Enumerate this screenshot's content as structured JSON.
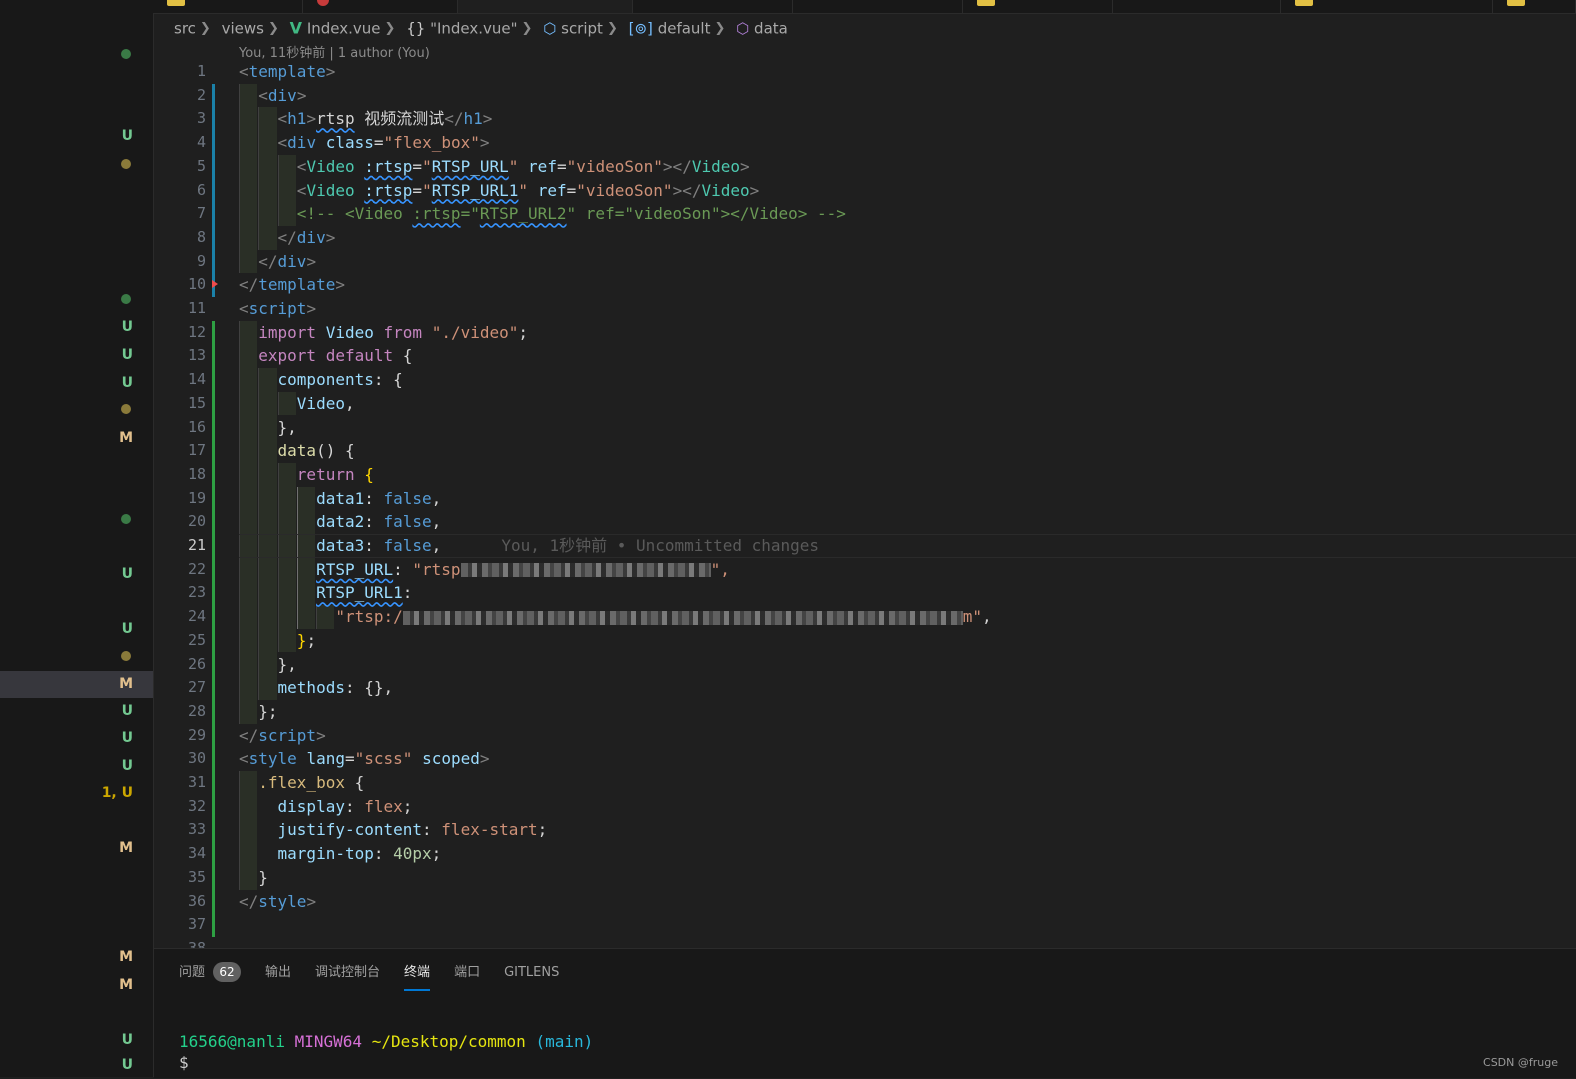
{
  "breadcrumb": {
    "items": [
      "src",
      "views",
      "Index.vue",
      "\"Index.vue\"",
      "script",
      "default",
      "data"
    ],
    "icons": [
      "vue-file-icon",
      "object-braces-icon",
      "cube-icon",
      "field-icon",
      "cube-icon"
    ]
  },
  "codelens": "You, 11秒钟前 | 1 author (You)",
  "scm_decorations": [
    {
      "kind": "dot",
      "color": "#3a7a46"
    },
    {
      "kind": "text",
      "text": "U",
      "color": "#73c991"
    },
    {
      "kind": "dot",
      "color": "#8a7a3a"
    },
    {
      "kind": "dot",
      "color": "#3a7a46"
    },
    {
      "kind": "text",
      "text": "U",
      "color": "#73c991"
    },
    {
      "kind": "text",
      "text": "U",
      "color": "#73c991"
    },
    {
      "kind": "text",
      "text": "U",
      "color": "#73c991"
    },
    {
      "kind": "dot",
      "color": "#8a7a3a"
    },
    {
      "kind": "text",
      "text": "M",
      "color": "#e2c08d"
    },
    {
      "kind": "dot",
      "color": "#3a7a46"
    },
    {
      "kind": "text",
      "text": "U",
      "color": "#73c991"
    },
    {
      "kind": "text",
      "text": "U",
      "color": "#73c991"
    },
    {
      "kind": "dot",
      "color": "#8a7a3a"
    },
    {
      "kind": "text",
      "text": "M",
      "color": "#e2c08d",
      "selected": true
    },
    {
      "kind": "text",
      "text": "U",
      "color": "#73c991"
    },
    {
      "kind": "text",
      "text": "U",
      "color": "#73c991"
    },
    {
      "kind": "text",
      "text": "U",
      "color": "#73c991"
    },
    {
      "kind": "text",
      "text": "1, U",
      "color": "#cca700"
    },
    {
      "kind": "text",
      "text": "M",
      "color": "#e2c08d"
    },
    {
      "kind": "text",
      "text": "M",
      "color": "#e2c08d"
    },
    {
      "kind": "text",
      "text": "M",
      "color": "#e2c08d"
    },
    {
      "kind": "text",
      "text": "U",
      "color": "#73c991"
    },
    {
      "kind": "text",
      "text": "U",
      "color": "#73c991"
    }
  ],
  "editor": {
    "current_line": 21,
    "line_numbers": [
      "1",
      "2",
      "3",
      "4",
      "5",
      "6",
      "7",
      "8",
      "9",
      "10",
      "11",
      "12",
      "13",
      "14",
      "15",
      "16",
      "17",
      "18",
      "19",
      "20",
      "21",
      "22",
      "23",
      "24",
      "25",
      "26",
      "27",
      "28",
      "29",
      "30",
      "31",
      "32",
      "33",
      "34",
      "35",
      "36",
      "37",
      "38"
    ],
    "blame_line": "You, 1秒钟前 • Uncommitted changes",
    "lines": [
      [
        [
          "t-br",
          "<"
        ],
        [
          "t-tag",
          "template"
        ],
        [
          "t-br",
          ">"
        ]
      ],
      [
        [
          "",
          "  "
        ],
        [
          "t-br",
          "<"
        ],
        [
          "t-tag",
          "div"
        ],
        [
          "t-br",
          ">"
        ]
      ],
      [
        [
          "",
          "    "
        ],
        [
          "t-br",
          "<"
        ],
        [
          "t-tag",
          "h1"
        ],
        [
          "t-br",
          ">"
        ],
        [
          "t-plain sq",
          "rtsp"
        ],
        [
          "t-plain",
          " 视频流测试"
        ],
        [
          "t-br",
          "</"
        ],
        [
          "t-tag",
          "h1"
        ],
        [
          "t-br",
          ">"
        ]
      ],
      [
        [
          "",
          "    "
        ],
        [
          "t-br",
          "<"
        ],
        [
          "t-tag",
          "div"
        ],
        [
          "t-plain",
          " "
        ],
        [
          "t-attr",
          "class"
        ],
        [
          "t-plain",
          "="
        ],
        [
          "t-str",
          "\"flex_box\""
        ],
        [
          "t-br",
          ">"
        ]
      ],
      [
        [
          "",
          "      "
        ],
        [
          "t-br",
          "<"
        ],
        [
          "t-cmp",
          "Video"
        ],
        [
          "t-plain",
          " "
        ],
        [
          "t-attr sq",
          ":rtsp"
        ],
        [
          "t-plain",
          "="
        ],
        [
          "t-str",
          "\""
        ],
        [
          "t-var sq",
          "RTSP_URL"
        ],
        [
          "t-str",
          "\""
        ],
        [
          "t-plain",
          " "
        ],
        [
          "t-attr",
          "ref"
        ],
        [
          "t-plain",
          "="
        ],
        [
          "t-str",
          "\"videoSon\""
        ],
        [
          "t-br",
          "></"
        ],
        [
          "t-cmp",
          "Video"
        ],
        [
          "t-br",
          ">"
        ]
      ],
      [
        [
          "",
          "      "
        ],
        [
          "t-br",
          "<"
        ],
        [
          "t-cmp",
          "Video"
        ],
        [
          "t-plain",
          " "
        ],
        [
          "t-attr sq",
          ":rtsp"
        ],
        [
          "t-plain",
          "="
        ],
        [
          "t-str",
          "\""
        ],
        [
          "t-var sq",
          "RTSP_URL1"
        ],
        [
          "t-str",
          "\""
        ],
        [
          "t-plain",
          " "
        ],
        [
          "t-attr",
          "ref"
        ],
        [
          "t-plain",
          "="
        ],
        [
          "t-str",
          "\"videoSon\""
        ],
        [
          "t-br",
          "></"
        ],
        [
          "t-cmp",
          "Video"
        ],
        [
          "t-br",
          ">"
        ]
      ],
      [
        [
          "",
          "      "
        ],
        [
          "t-cmt",
          "<!-- <Video "
        ],
        [
          "t-cmt sq",
          ":rtsp"
        ],
        [
          "t-cmt",
          "=\""
        ],
        [
          "t-cmt sq",
          "RTSP_URL2"
        ],
        [
          "t-cmt",
          "\" ref=\"videoSon\"></Video> -->"
        ]
      ],
      [
        [
          "",
          "    "
        ],
        [
          "t-br",
          "</"
        ],
        [
          "t-tag",
          "div"
        ],
        [
          "t-br",
          ">"
        ]
      ],
      [
        [
          "",
          "  "
        ],
        [
          "t-br",
          "</"
        ],
        [
          "t-tag",
          "div"
        ],
        [
          "t-br",
          ">"
        ]
      ],
      [
        [
          "t-br",
          "</"
        ],
        [
          "t-tag",
          "template"
        ],
        [
          "t-br",
          ">"
        ]
      ],
      [
        [
          "t-br",
          "<"
        ],
        [
          "t-tag",
          "script"
        ],
        [
          "t-br",
          ">"
        ]
      ],
      [
        [
          "",
          "  "
        ],
        [
          "t-kw",
          "import"
        ],
        [
          "t-plain",
          " "
        ],
        [
          "t-var",
          "Video"
        ],
        [
          "t-plain",
          " "
        ],
        [
          "t-kw",
          "from"
        ],
        [
          "t-plain",
          " "
        ],
        [
          "t-str",
          "\"./video\""
        ],
        [
          "t-plain",
          ";"
        ]
      ],
      [
        [
          "",
          "  "
        ],
        [
          "t-kw",
          "export"
        ],
        [
          "t-plain",
          " "
        ],
        [
          "t-kw",
          "default"
        ],
        [
          "t-plain",
          " {"
        ]
      ],
      [
        [
          "",
          "    "
        ],
        [
          "t-prop",
          "components"
        ],
        [
          "t-plain",
          ": {"
        ]
      ],
      [
        [
          "",
          "      "
        ],
        [
          "t-var",
          "Video"
        ],
        [
          "t-plain",
          ","
        ]
      ],
      [
        [
          "",
          "    "
        ],
        [
          "t-plain",
          "},"
        ]
      ],
      [
        [
          "",
          "    "
        ],
        [
          "t-fn",
          "data"
        ],
        [
          "t-plain",
          "() {"
        ]
      ],
      [
        [
          "",
          "      "
        ],
        [
          "t-kw",
          "return"
        ],
        [
          "t-plain",
          " "
        ],
        [
          "t-brace",
          "{"
        ]
      ],
      [
        [
          "",
          "        "
        ],
        [
          "t-prop",
          "data1"
        ],
        [
          "t-plain",
          ": "
        ],
        [
          "t-bool",
          "false"
        ],
        [
          "t-plain",
          ","
        ]
      ],
      [
        [
          "",
          "        "
        ],
        [
          "t-prop",
          "data2"
        ],
        [
          "t-plain",
          ": "
        ],
        [
          "t-bool",
          "false"
        ],
        [
          "t-plain",
          ","
        ]
      ],
      [
        [
          "",
          "        "
        ],
        [
          "t-prop",
          "data3"
        ],
        [
          "t-plain",
          ": "
        ],
        [
          "t-bool",
          "false"
        ],
        [
          "t-plain",
          ","
        ]
      ],
      [
        [
          "",
          "        "
        ],
        [
          "t-prop sq",
          "RTSP_URL"
        ],
        [
          "t-plain",
          ": "
        ],
        [
          "t-str",
          "\"rtsp"
        ],
        [
          "blur:250",
          ""
        ],
        [
          "t-str",
          "\","
        ]
      ],
      [
        [
          "",
          "        "
        ],
        [
          "t-prop sq",
          "RTSP_URL1"
        ],
        [
          "t-plain",
          ":"
        ]
      ],
      [
        [
          "",
          "          "
        ],
        [
          "t-str",
          "\"rtsp:/"
        ],
        [
          "blur:560",
          ""
        ],
        [
          "t-str",
          "m\""
        ],
        [
          "t-plain",
          ","
        ]
      ],
      [
        [
          "",
          "      "
        ],
        [
          "t-brace",
          "}"
        ],
        [
          "t-plain",
          ";"
        ]
      ],
      [
        [
          "",
          "    "
        ],
        [
          "t-plain",
          "},"
        ]
      ],
      [
        [
          "",
          "    "
        ],
        [
          "t-prop",
          "methods"
        ],
        [
          "t-plain",
          ": {},"
        ]
      ],
      [
        [
          "",
          "  "
        ],
        [
          "t-plain",
          "};"
        ]
      ],
      [
        [
          "t-br",
          "</"
        ],
        [
          "t-tag",
          "script"
        ],
        [
          "t-br",
          ">"
        ]
      ],
      [
        [
          "t-br",
          "<"
        ],
        [
          "t-tag",
          "style"
        ],
        [
          "t-plain",
          " "
        ],
        [
          "t-attr",
          "lang"
        ],
        [
          "t-plain",
          "="
        ],
        [
          "t-str",
          "\"scss\""
        ],
        [
          "t-plain",
          " "
        ],
        [
          "t-attr",
          "scoped"
        ],
        [
          "t-br",
          ">"
        ]
      ],
      [
        [
          "",
          "  "
        ],
        [
          "t-sel",
          ".flex_box"
        ],
        [
          "t-plain",
          " {"
        ]
      ],
      [
        [
          "",
          "    "
        ],
        [
          "t-prop",
          "display"
        ],
        [
          "t-plain",
          ": "
        ],
        [
          "t-str",
          "flex"
        ],
        [
          "t-plain",
          ";"
        ]
      ],
      [
        [
          "",
          "    "
        ],
        [
          "t-prop",
          "justify-content"
        ],
        [
          "t-plain",
          ": "
        ],
        [
          "t-str",
          "flex-start"
        ],
        [
          "t-plain",
          ";"
        ]
      ],
      [
        [
          "",
          "    "
        ],
        [
          "t-prop",
          "margin-top"
        ],
        [
          "t-plain",
          ": "
        ],
        [
          "t-num",
          "40px"
        ],
        [
          "t-plain",
          ";"
        ]
      ],
      [
        [
          "",
          "  "
        ],
        [
          "t-plain",
          "}"
        ]
      ],
      [
        [
          "t-br",
          "</"
        ],
        [
          "t-tag",
          "style"
        ],
        [
          "t-br",
          ">"
        ]
      ],
      [],
      []
    ]
  },
  "panel": {
    "tabs": [
      {
        "label": "问题",
        "badge": "62"
      },
      {
        "label": "输出"
      },
      {
        "label": "调试控制台"
      },
      {
        "label": "终端",
        "active": true
      },
      {
        "label": "端口"
      },
      {
        "label": "GITLENS"
      }
    ],
    "terminal": {
      "user_host": "16566@nanli",
      "system": "MINGW64",
      "path": "~/Desktop/common",
      "branch": "(main)",
      "prompt": "$"
    }
  },
  "watermark": "CSDN @fruge"
}
